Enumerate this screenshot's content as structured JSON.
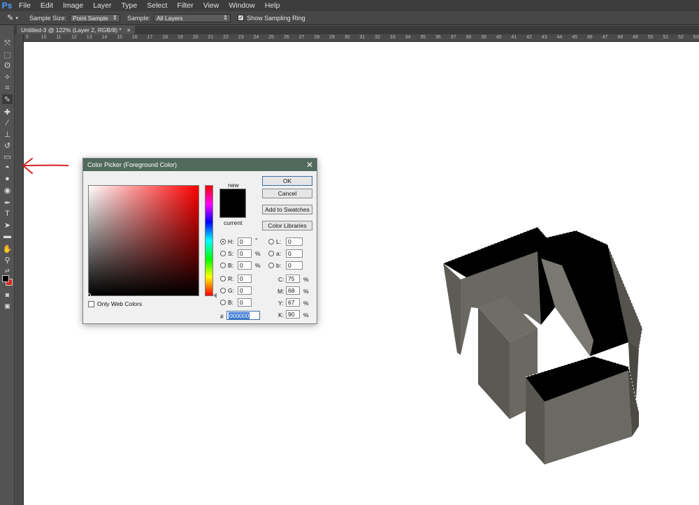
{
  "app": {
    "logo": "Ps"
  },
  "menu": [
    "File",
    "Edit",
    "Image",
    "Layer",
    "Type",
    "Select",
    "Filter",
    "View",
    "Window",
    "Help"
  ],
  "options": {
    "sample_size_label": "Sample Size:",
    "sample_size_value": "Point Sample",
    "sample_label": "Sample:",
    "sample_value": "All Layers",
    "show_ring_label": "Show Sampling Ring",
    "show_ring_checked": true
  },
  "document_tab": {
    "title": "Untitled-3 @ 122% (Layer 2, RGB/8) *",
    "close": "×"
  },
  "ruler_top": [
    "5",
    "10",
    "11",
    "12",
    "13",
    "14",
    "15",
    "16",
    "17",
    "18",
    "19",
    "20",
    "21",
    "22",
    "23",
    "24",
    "25",
    "26",
    "27",
    "28",
    "29",
    "30",
    "31",
    "32",
    "33",
    "34",
    "35",
    "36",
    "37",
    "38",
    "39",
    "40",
    "41",
    "42",
    "43",
    "44",
    "45",
    "46",
    "47",
    "48",
    "49",
    "50",
    "51",
    "52",
    "53"
  ],
  "dialog": {
    "title": "Color Picker (Foreground Color)",
    "close": "✕",
    "new_label": "new",
    "current_label": "current",
    "ok": "OK",
    "cancel": "Cancel",
    "add_swatches": "Add to Swatches",
    "color_libraries": "Color Libraries",
    "only_web_colors": "Only Web Colors",
    "H": {
      "label": "H:",
      "value": "0",
      "unit": "°"
    },
    "S": {
      "label": "S:",
      "value": "0",
      "unit": "%"
    },
    "Bv": {
      "label": "B:",
      "value": "0",
      "unit": "%"
    },
    "R": {
      "label": "R:",
      "value": "0"
    },
    "G": {
      "label": "G:",
      "value": "0"
    },
    "Bb": {
      "label": "B:",
      "value": "0"
    },
    "L": {
      "label": "L:",
      "value": "0"
    },
    "a": {
      "label": "a:",
      "value": "0"
    },
    "b": {
      "label": "b:",
      "value": "0"
    },
    "C": {
      "label": "C:",
      "value": "75",
      "unit": "%"
    },
    "M": {
      "label": "M:",
      "value": "68",
      "unit": "%"
    },
    "Y": {
      "label": "Y:",
      "value": "67",
      "unit": "%"
    },
    "K": {
      "label": "K:",
      "value": "90",
      "unit": "%"
    },
    "hex_label": "#",
    "hex_value": "000000"
  },
  "colors": {
    "foreground": "#000000",
    "background": "#d9241b",
    "annotation_arrow": "#d0221f",
    "title_bar": "#506a5c"
  }
}
